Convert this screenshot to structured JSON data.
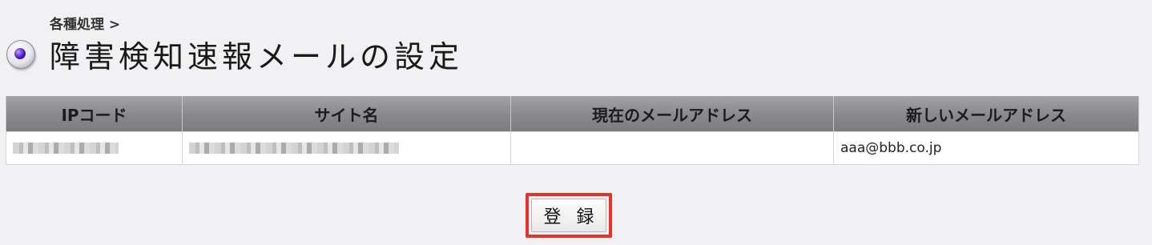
{
  "breadcrumb": "各種処理 >",
  "page_title": "障害検知速報メールの設定",
  "table": {
    "headers": [
      "IPコード",
      "サイト名",
      "現在のメールアドレス",
      "新しいメールアドレス"
    ],
    "rows": [
      {
        "ip_code": "",
        "site_name": "",
        "current_email": "",
        "new_email": "aaa@bbb.co.jp"
      }
    ]
  },
  "register_label": "登 録",
  "colors": {
    "highlight": "#e3352a",
    "header_bg": "#8a8a8f",
    "page_bg": "#f1f1f4",
    "bullet": "#4b17c8"
  }
}
